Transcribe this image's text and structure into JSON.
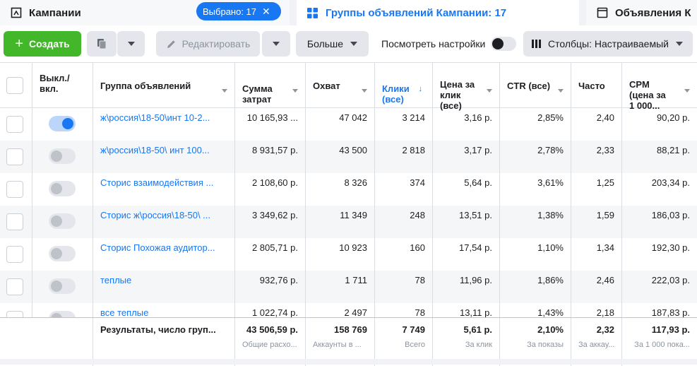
{
  "tabs": {
    "campaigns": "Кампании",
    "selected": "Выбрано: 17",
    "adsets": "Группы объявлений Кампании: 17",
    "ads": "Объявления К"
  },
  "toolbar": {
    "create": "Создать",
    "edit": "Редактировать",
    "more": "Больше",
    "view_settings": "Посмотреть настройки",
    "columns": "Столбцы: Настраиваемый"
  },
  "columns": [
    {
      "label": "Выкл./\nвкл."
    },
    {
      "label": "Группа объявлений"
    },
    {
      "label": "Сумма\nзатрат"
    },
    {
      "label": "Охват"
    },
    {
      "label": "Клики\n(все)"
    },
    {
      "label": "Цена за\nклик\n(все)"
    },
    {
      "label": "CTR (все)"
    },
    {
      "label": "Часто"
    },
    {
      "label": "CPM\n(цена за\n1 000..."
    }
  ],
  "rows": [
    {
      "on": true,
      "name": "ж\\россия\\18-50\\инт 10-2...",
      "spend": "10 165,93 ...",
      "reach": "47 042",
      "clicks": "3 214",
      "cpc": "3,16 р.",
      "ctr": "2,85%",
      "freq": "2,40",
      "cpm": "90,20 р."
    },
    {
      "on": false,
      "name": "ж\\россия\\18-50\\ инт 100...",
      "spend": "8 931,57 р.",
      "reach": "43 500",
      "clicks": "2 818",
      "cpc": "3,17 р.",
      "ctr": "2,78%",
      "freq": "2,33",
      "cpm": "88,21 р."
    },
    {
      "on": false,
      "name": "Сторис взаимодействия ...",
      "spend": "2 108,60 р.",
      "reach": "8 326",
      "clicks": "374",
      "cpc": "5,64 р.",
      "ctr": "3,61%",
      "freq": "1,25",
      "cpm": "203,34 р."
    },
    {
      "on": false,
      "name": "Сторис ж\\россия\\18-50\\ ...",
      "spend": "3 349,62 р.",
      "reach": "11 349",
      "clicks": "248",
      "cpc": "13,51 р.",
      "ctr": "1,38%",
      "freq": "1,59",
      "cpm": "186,03 р."
    },
    {
      "on": false,
      "name": "Сторис Похожая аудитор...",
      "spend": "2 805,71 р.",
      "reach": "10 923",
      "clicks": "160",
      "cpc": "17,54 р.",
      "ctr": "1,10%",
      "freq": "1,34",
      "cpm": "192,30 р."
    },
    {
      "on": false,
      "name": "теплые",
      "spend": "932,76 р.",
      "reach": "1 711",
      "clicks": "78",
      "cpc": "11,96 р.",
      "ctr": "1,86%",
      "freq": "2,46",
      "cpm": "222,03 р."
    },
    {
      "on": false,
      "name": "все теплые",
      "spend": "1 022,74 р.",
      "reach": "2 497",
      "clicks": "78",
      "cpc": "13,11 р.",
      "ctr": "1,43%",
      "freq": "2,18",
      "cpm": "187,83 р."
    }
  ],
  "totals": {
    "label": "Результаты, число груп...",
    "spend": "43 506,59 р.",
    "spend_sub": "Общие расхо...",
    "reach": "158 769",
    "reach_sub": "Аккаунты в ...",
    "clicks": "7 749",
    "clicks_sub": "Всего",
    "cpc": "5,61 р.",
    "cpc_sub": "За клик",
    "ctr": "2,10%",
    "ctr_sub": "За показы",
    "freq": "2,32",
    "freq_sub": "За аккау...",
    "cpm": "117,93 р.",
    "cpm_sub": "За 1 000 пока..."
  }
}
